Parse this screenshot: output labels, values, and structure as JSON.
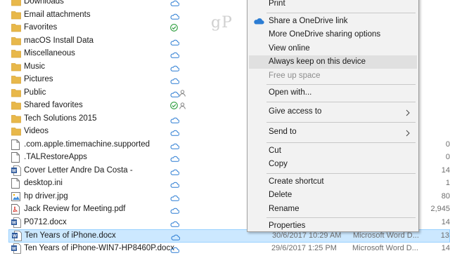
{
  "watermark": "gP",
  "files": [
    {
      "name": "Downloads",
      "kind": "folder",
      "status": [
        "cloud"
      ],
      "modified": "",
      "type": "",
      "size": ""
    },
    {
      "name": "Email attachments",
      "kind": "folder",
      "status": [
        "cloud"
      ],
      "modified": "",
      "type": "",
      "size": ""
    },
    {
      "name": "Favorites",
      "kind": "folder",
      "status": [
        "check"
      ],
      "modified": "",
      "type": "",
      "size": ""
    },
    {
      "name": "macOS Install Data",
      "kind": "folder",
      "status": [
        "cloud"
      ],
      "modified": "",
      "type": "",
      "size": ""
    },
    {
      "name": "Miscellaneous",
      "kind": "folder",
      "status": [
        "cloud"
      ],
      "modified": "",
      "type": "",
      "size": ""
    },
    {
      "name": "Music",
      "kind": "folder",
      "status": [
        "cloud"
      ],
      "modified": "",
      "type": "",
      "size": ""
    },
    {
      "name": "Pictures",
      "kind": "folder",
      "status": [
        "cloud"
      ],
      "modified": "",
      "type": "",
      "size": ""
    },
    {
      "name": "Public",
      "kind": "folder",
      "status": [
        "cloud",
        "person"
      ],
      "modified": "",
      "type": "",
      "size": ""
    },
    {
      "name": "Shared favorites",
      "kind": "folder",
      "status": [
        "check",
        "person"
      ],
      "modified": "",
      "type": "",
      "size": ""
    },
    {
      "name": "Tech Solutions 2015",
      "kind": "folder",
      "status": [
        "cloud"
      ],
      "modified": "",
      "type": "",
      "size": ""
    },
    {
      "name": "Videos",
      "kind": "folder",
      "status": [
        "cloud"
      ],
      "modified": "",
      "type": "",
      "size": ""
    },
    {
      "name": ".com.apple.timemachine.supported",
      "kind": "file",
      "status": [
        "cloud"
      ],
      "modified": "",
      "type": "",
      "size": "0"
    },
    {
      "name": ".TALRestoreApps",
      "kind": "file",
      "status": [
        "cloud"
      ],
      "modified": "",
      "type": "",
      "size": "0"
    },
    {
      "name": "Cover Letter Andre Da Costa -",
      "kind": "word",
      "status": [
        "cloud"
      ],
      "modified": "",
      "type": "",
      "size": "14"
    },
    {
      "name": "desktop.ini",
      "kind": "file",
      "status": [
        "cloud"
      ],
      "modified": "",
      "type": "",
      "size": "1"
    },
    {
      "name": "hp driver.jpg",
      "kind": "image",
      "status": [
        "cloud"
      ],
      "modified": "",
      "type": "",
      "size": "80"
    },
    {
      "name": "Jack Review for Meeting.pdf",
      "kind": "pdf",
      "status": [
        "cloud"
      ],
      "modified": "",
      "type": "",
      "size": "2,945"
    },
    {
      "name": "P0712.docx",
      "kind": "word",
      "status": [
        "cloud"
      ],
      "modified": "",
      "type": "",
      "size": "14"
    },
    {
      "name": "Ten Years of iPhone.docx",
      "kind": "word",
      "status": [
        "cloud"
      ],
      "modified": "30/6/2017 10:29 AM",
      "type": "Microsoft Word D...",
      "size": "13",
      "selected": true
    },
    {
      "name": "Ten Years of iPhone-WIN7-HP8460P.docx",
      "kind": "word",
      "status": [
        "cloud"
      ],
      "modified": "29/6/2017 1:25 PM",
      "type": "Microsoft Word D...",
      "size": "14"
    }
  ],
  "context_menu": {
    "items": [
      {
        "label": "Print",
        "type": "item"
      },
      {
        "type": "sep"
      },
      {
        "label": "Share a OneDrive link",
        "type": "item",
        "icon": "onedrive"
      },
      {
        "label": "More OneDrive sharing options",
        "type": "item"
      },
      {
        "label": "View online",
        "type": "item"
      },
      {
        "label": "Always keep on this device",
        "type": "item",
        "hover": true
      },
      {
        "label": "Free up space",
        "type": "item",
        "disabled": true
      },
      {
        "type": "sep"
      },
      {
        "label": "Open with...",
        "type": "item"
      },
      {
        "type": "sep"
      },
      {
        "label": "Give access to",
        "type": "item",
        "submenu": true
      },
      {
        "type": "sep"
      },
      {
        "label": "Send to",
        "type": "item",
        "submenu": true
      },
      {
        "type": "sep"
      },
      {
        "label": "Cut",
        "type": "item"
      },
      {
        "label": "Copy",
        "type": "item"
      },
      {
        "type": "sep"
      },
      {
        "label": "Create shortcut",
        "type": "item"
      },
      {
        "label": "Delete",
        "type": "item"
      },
      {
        "label": "Rename",
        "type": "item"
      },
      {
        "type": "sep"
      },
      {
        "label": "Properties",
        "type": "item"
      }
    ]
  },
  "colors": {
    "folder": "#e8b84a",
    "folder_dark": "#d9a53a",
    "cloud": "#2b7cd3",
    "check": "#2e9e3e",
    "person": "#777777",
    "word": "#2b579a",
    "selected_bg": "#cce8ff"
  }
}
